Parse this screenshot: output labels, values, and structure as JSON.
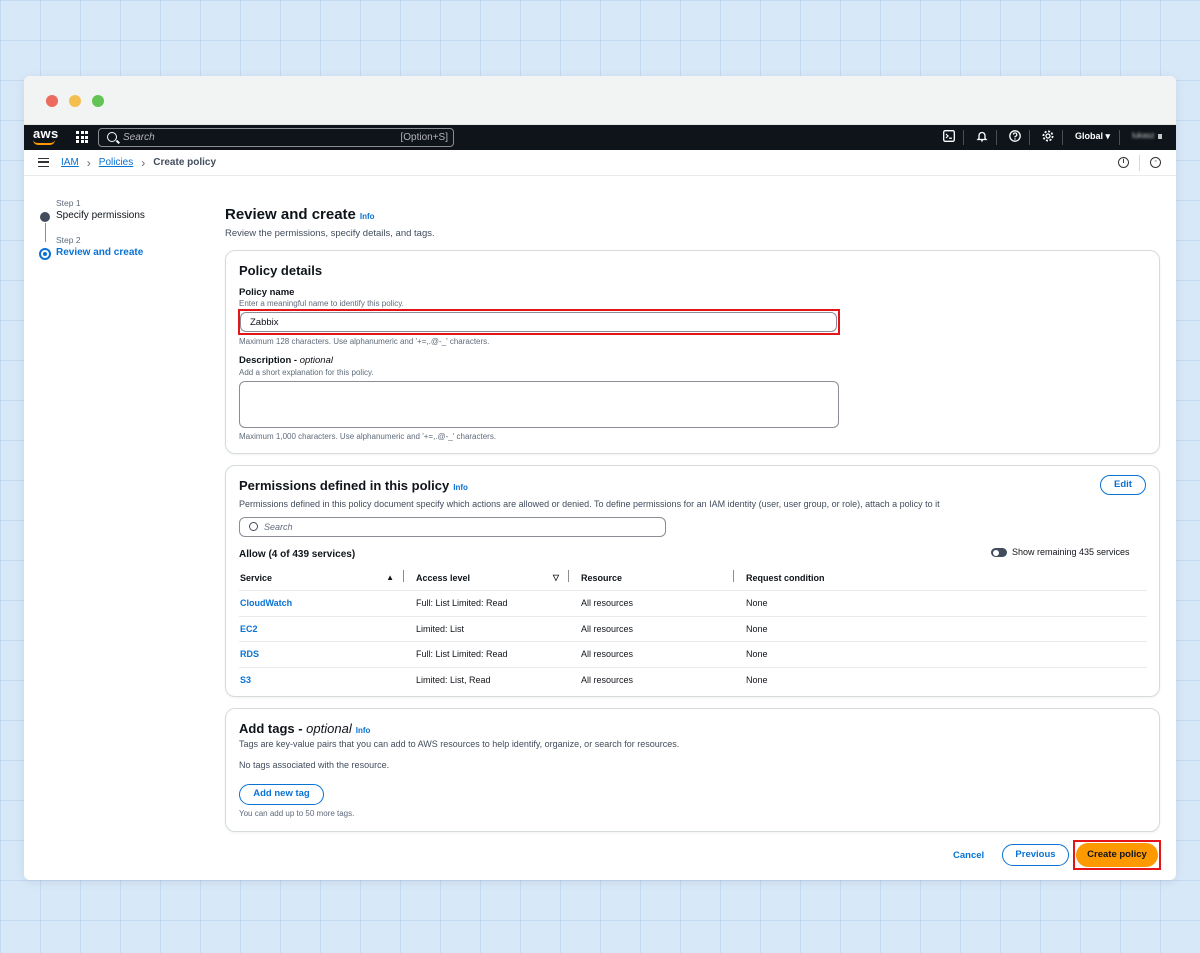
{
  "topnav": {
    "logo": "aws",
    "search_placeholder": "Search",
    "search_shortcut": "[Option+S]",
    "region": "Global ▾",
    "account": "lukasz"
  },
  "breadcrumb": {
    "items": [
      "IAM",
      "Policies"
    ],
    "current": "Create policy"
  },
  "steps": [
    {
      "label": "Step 1",
      "name": "Specify permissions"
    },
    {
      "label": "Step 2",
      "name": "Review and create"
    }
  ],
  "page": {
    "title": "Review and create",
    "info": "Info",
    "description": "Review the permissions, specify details, and tags."
  },
  "policy_details": {
    "title": "Policy details",
    "name_label": "Policy name",
    "name_hint": "Enter a meaningful name to identify this policy.",
    "name_value": "Zabbix",
    "name_constraint": "Maximum 128 characters. Use alphanumeric and '+=,.@-_' characters.",
    "desc_label": "Description - ",
    "desc_optional": "optional",
    "desc_hint": "Add a short explanation for this policy.",
    "desc_value": "",
    "desc_constraint": "Maximum 1,000 characters. Use alphanumeric and '+=,.@-_' characters."
  },
  "permissions": {
    "title": "Permissions defined in this policy",
    "info": "Info",
    "edit": "Edit",
    "description": "Permissions defined in this policy document specify which actions are allowed or denied. To define permissions for an IAM identity (user, user group, or role), attach a policy to it",
    "search_placeholder": "Search",
    "allow_heading": "Allow (4 of 439 services)",
    "show_remaining": "Show remaining 435 services",
    "columns": [
      "Service",
      "Access level",
      "Resource",
      "Request condition"
    ],
    "rows": [
      {
        "service": "CloudWatch",
        "access": "Full: List Limited: Read",
        "resource": "All resources",
        "condition": "None"
      },
      {
        "service": "EC2",
        "access": "Limited: List",
        "resource": "All resources",
        "condition": "None"
      },
      {
        "service": "RDS",
        "access": "Full: List Limited: Read",
        "resource": "All resources",
        "condition": "None"
      },
      {
        "service": "S3",
        "access": "Limited: List, Read",
        "resource": "All resources",
        "condition": "None"
      }
    ]
  },
  "tags": {
    "title": "Add tags - ",
    "title_optional": "optional",
    "info": "Info",
    "description": "Tags are key-value pairs that you can add to AWS resources to help identify, organize, or search for resources.",
    "empty": "No tags associated with the resource.",
    "add_button": "Add new tag",
    "limit": "You can add up to 50 more tags."
  },
  "footer": {
    "cancel": "Cancel",
    "previous": "Previous",
    "create": "Create policy"
  },
  "colors": {
    "accent": "#0972d3",
    "primary_button": "#ff9900",
    "highlight": "#e3141a"
  }
}
